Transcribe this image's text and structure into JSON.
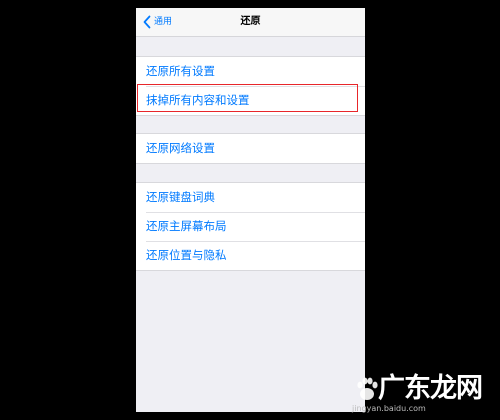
{
  "nav": {
    "back_label": "通用",
    "title": "还原"
  },
  "groups": [
    {
      "items": [
        {
          "label": "还原所有设置"
        },
        {
          "label": "抹掉所有内容和设置"
        }
      ]
    },
    {
      "items": [
        {
          "label": "还原网络设置"
        }
      ]
    },
    {
      "items": [
        {
          "label": "还原键盘词典"
        },
        {
          "label": "还原主屏幕布局"
        },
        {
          "label": "还原位置与隐私"
        }
      ]
    }
  ],
  "highlighted_item": "抹掉所有内容和设置",
  "watermark": {
    "text": "广东龙网",
    "subtext": "jingyan.baidu.com"
  },
  "colors": {
    "accent": "#007aff",
    "highlight": "#e8262a",
    "background": "#efeff4"
  },
  "icons": [
    "chevron-left-icon",
    "baidu-paw-icon"
  ]
}
